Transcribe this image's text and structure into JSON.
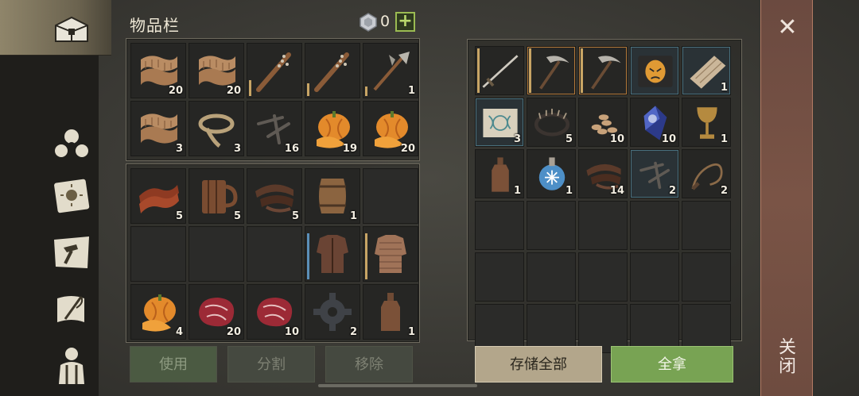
{
  "title": "物品栏",
  "currency": {
    "icon": "gem-icon",
    "count": "0",
    "add_label": "+"
  },
  "sidebar": {
    "icons": [
      "chest-icon",
      "cluster-icon",
      "sun-book-icon",
      "hammer-map-icon",
      "scroll-quill-icon",
      "survivor-icon"
    ]
  },
  "inventory_top": [
    {
      "icon": "cloth-icon",
      "qty": "20"
    },
    {
      "icon": "cloth-icon",
      "qty": "20"
    },
    {
      "icon": "spiked-club-icon",
      "qty": ""
    },
    {
      "icon": "spiked-club-icon",
      "qty": ""
    },
    {
      "icon": "halberd-icon",
      "qty": "1"
    },
    {
      "icon": "cloth-icon",
      "qty": "3"
    },
    {
      "icon": "rope-icon",
      "qty": "3"
    },
    {
      "icon": "nails-icon",
      "qty": "16"
    },
    {
      "icon": "pumpkin-icon",
      "qty": "19"
    },
    {
      "icon": "pumpkin-icon",
      "qty": "20"
    }
  ],
  "inventory_bottom": [
    {
      "icon": "bacon-icon",
      "qty": "5"
    },
    {
      "icon": "mug-icon",
      "qty": "5"
    },
    {
      "icon": "leather-icon",
      "qty": "5"
    },
    {
      "icon": "barrel-icon",
      "qty": "1"
    },
    {
      "icon": "",
      "qty": ""
    },
    {
      "icon": "",
      "qty": ""
    },
    {
      "icon": "",
      "qty": ""
    },
    {
      "icon": "",
      "qty": ""
    },
    {
      "icon": "leather-armor-icon",
      "qty": ""
    },
    {
      "icon": "chainmail-icon",
      "qty": ""
    },
    {
      "icon": "pumpkin-icon",
      "qty": "4"
    },
    {
      "icon": "steak-icon",
      "qty": "20"
    },
    {
      "icon": "steak-icon",
      "qty": "10"
    },
    {
      "icon": "gear-icon",
      "qty": "2"
    },
    {
      "icon": "bottle-icon",
      "qty": "1"
    }
  ],
  "storage": [
    {
      "icon": "sword-icon",
      "qty": ""
    },
    {
      "icon": "pickaxe-icon",
      "qty": ""
    },
    {
      "icon": "pickaxe-icon",
      "qty": ""
    },
    {
      "icon": "mask-book-icon",
      "qty": ""
    },
    {
      "icon": "plank-icon",
      "qty": "1"
    },
    {
      "icon": "map-scroll-icon",
      "qty": "3"
    },
    {
      "icon": "bear-trap-icon",
      "qty": "5"
    },
    {
      "icon": "seeds-icon",
      "qty": "10"
    },
    {
      "icon": "crystal-icon",
      "qty": "10"
    },
    {
      "icon": "goblet-icon",
      "qty": "1"
    },
    {
      "icon": "bottle-icon",
      "qty": "1"
    },
    {
      "icon": "frost-potion-icon",
      "qty": "1"
    },
    {
      "icon": "leather-icon",
      "qty": "14"
    },
    {
      "icon": "nails-icon",
      "qty": "2"
    },
    {
      "icon": "whip-icon",
      "qty": "2"
    },
    {
      "icon": "",
      "qty": ""
    },
    {
      "icon": "",
      "qty": ""
    },
    {
      "icon": "",
      "qty": ""
    },
    {
      "icon": "",
      "qty": ""
    },
    {
      "icon": "",
      "qty": ""
    },
    {
      "icon": "",
      "qty": ""
    },
    {
      "icon": "",
      "qty": ""
    },
    {
      "icon": "",
      "qty": ""
    },
    {
      "icon": "",
      "qty": ""
    },
    {
      "icon": "",
      "qty": ""
    },
    {
      "icon": "",
      "qty": ""
    },
    {
      "icon": "",
      "qty": ""
    },
    {
      "icon": "",
      "qty": ""
    },
    {
      "icon": "",
      "qty": ""
    },
    {
      "icon": "",
      "qty": ""
    }
  ],
  "actions": {
    "use": "使用",
    "split": "分割",
    "remove": "移除",
    "store_all": "存储全部",
    "take_all": "全拿"
  },
  "close": {
    "icon": "close-icon",
    "symbol": "✕",
    "label": "关闭"
  },
  "colors": {
    "accent_green": "#78a353",
    "close_panel": "#7a5446",
    "store_button": "#b3a68b"
  }
}
